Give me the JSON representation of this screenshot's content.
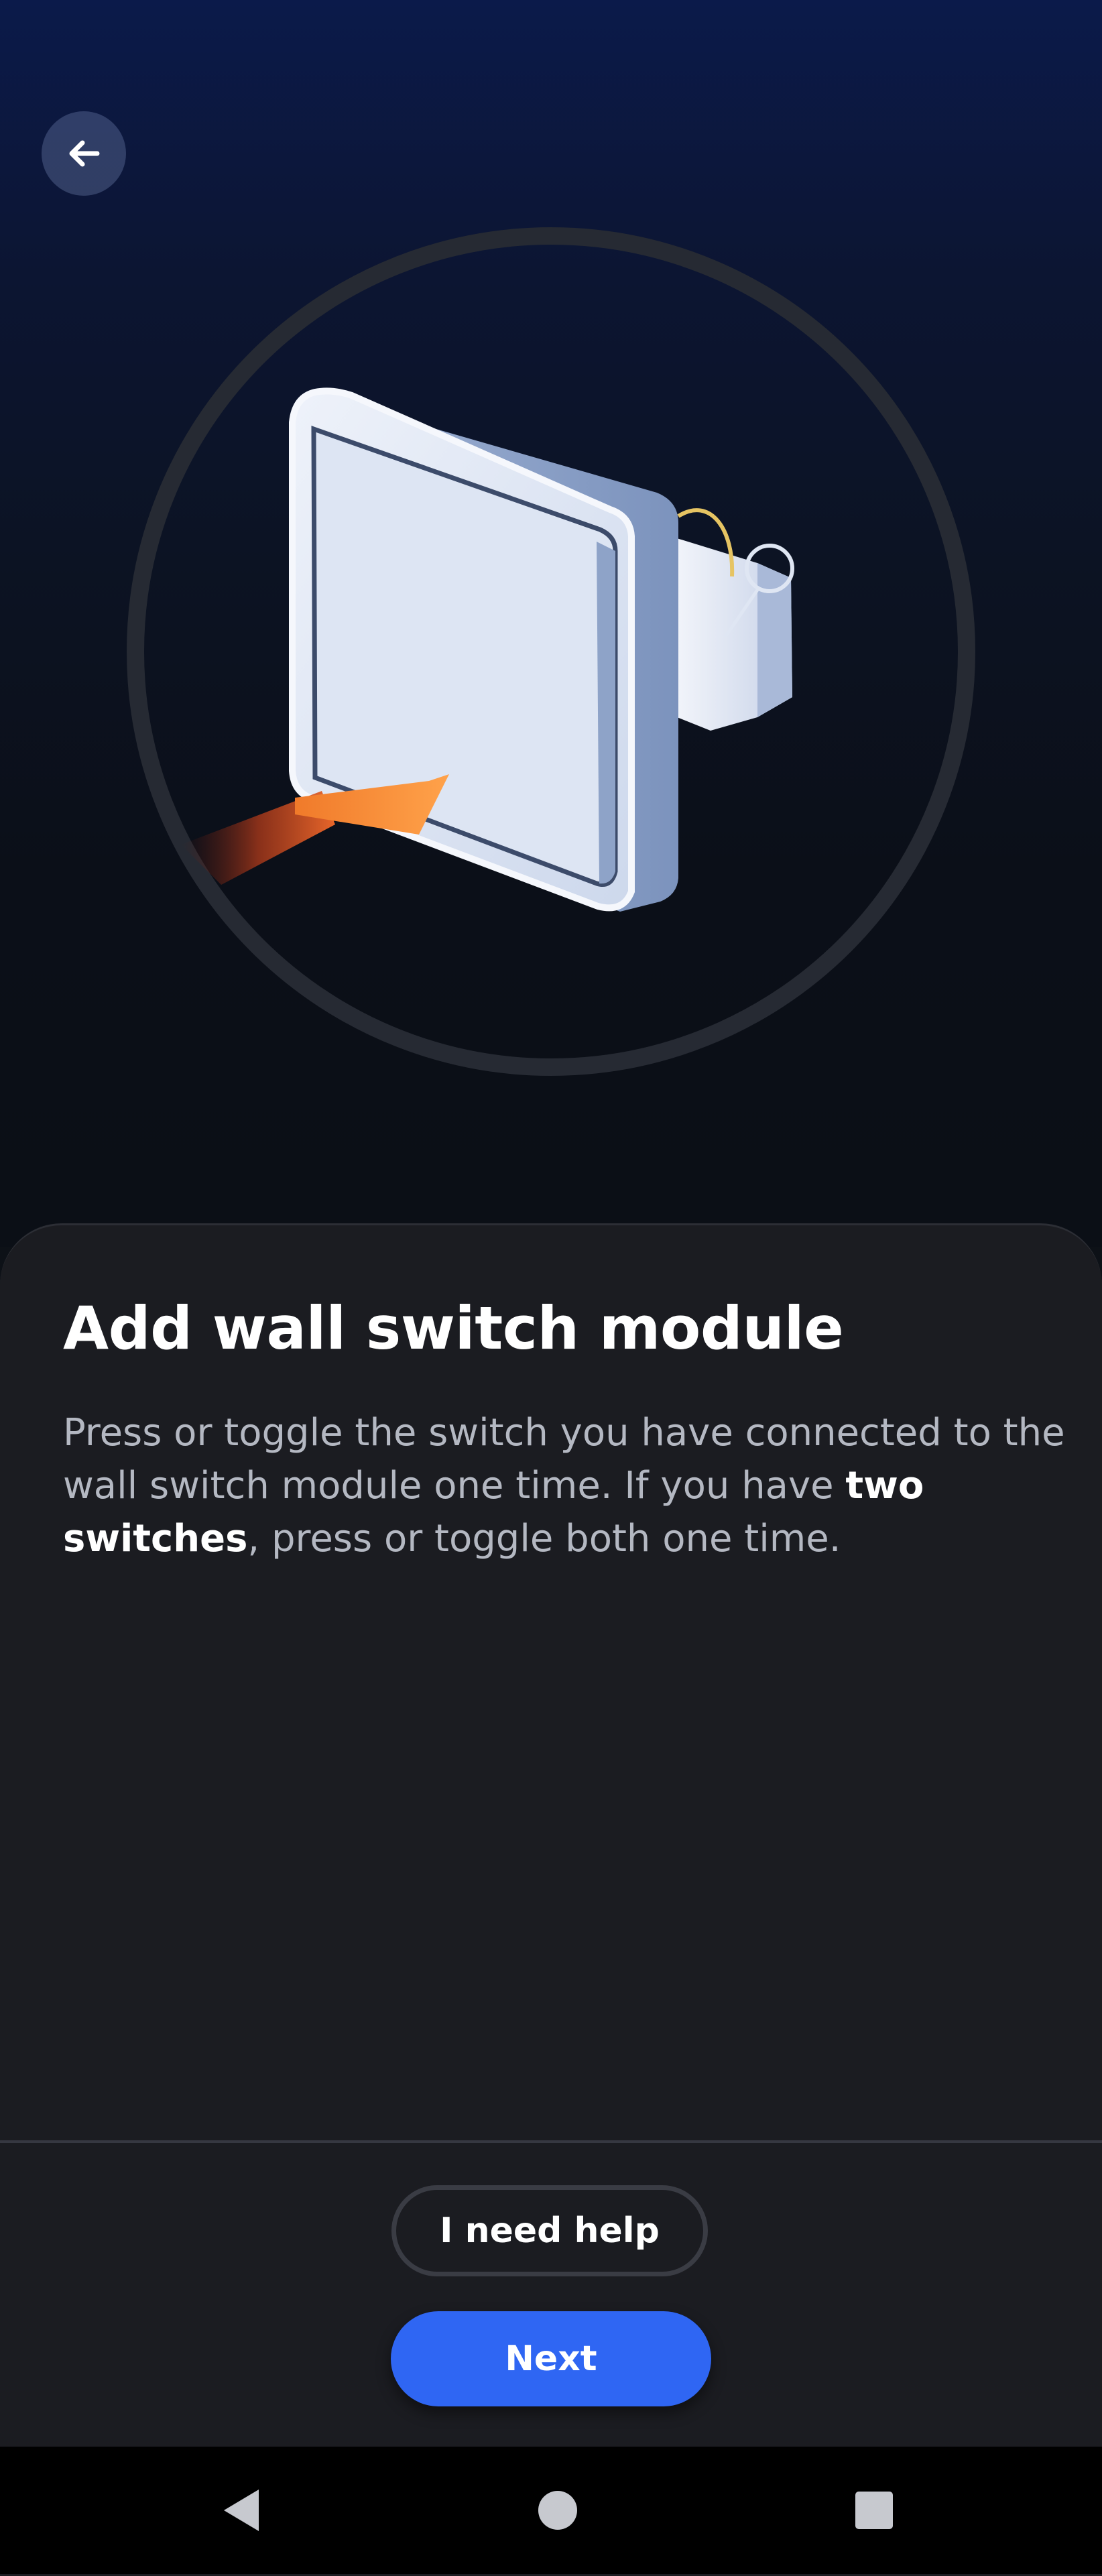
{
  "header": {
    "back_icon": "arrow-left-icon"
  },
  "illustration": {
    "description_icon": "wall-switch-press-illustration",
    "accent_color": "#f08a30"
  },
  "content": {
    "title": "Add wall switch module",
    "description_part1": "Press or toggle the switch you have connected to the wall switch module one time. If you have ",
    "description_bold1": "two switches",
    "description_part2": ", press or toggle both one time."
  },
  "actions": {
    "help_label": "I need help",
    "next_label": "Next",
    "primary_color": "#2f66f3"
  },
  "system_nav": {
    "back_icon": "triangle-back-icon",
    "home_icon": "circle-home-icon",
    "recents_icon": "square-recents-icon"
  }
}
